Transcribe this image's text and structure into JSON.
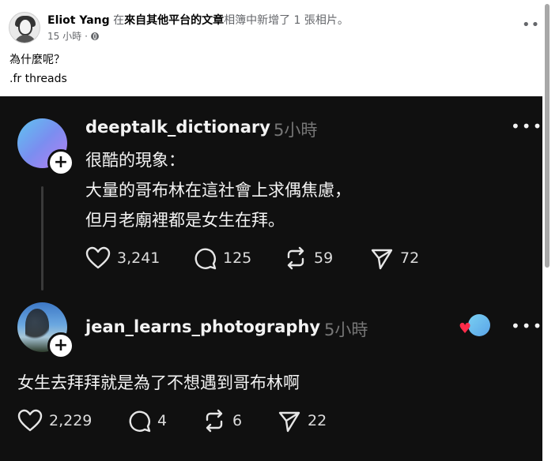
{
  "facebook_post": {
    "author": "Eliot Yang",
    "action_prefix": " 在",
    "album": "來自其他平台的文章",
    "action_suffix": "相簿中新增了 1 張相片。",
    "time": "15 小時",
    "time_sep": " · ",
    "privacy_icon": "globe-icon",
    "more_icon": "more-horizontal-icon",
    "text_line_1": "為什麼呢？",
    "text_line_2": ".fr threads"
  },
  "threads_post": {
    "username": "deeptalk_dictionary",
    "time": "5小時",
    "lines": [
      "很酷的現象：",
      "大量的哥布林在這社會上求偶焦慮，",
      "但月老廟裡都是女生在拜。"
    ],
    "stats": {
      "likes": "3,241",
      "comments": "125",
      "reposts": "59",
      "shares": "72"
    }
  },
  "threads_reply": {
    "username": "jean_learns_photography",
    "time": "5小時",
    "text": "女生去拜拜就是為了不想遇到哥布林啊",
    "stats": {
      "likes": "2,229",
      "comments": "4",
      "reposts": "6",
      "shares": "22"
    }
  },
  "icons": {
    "follow": "plus-icon",
    "like": "heart-icon",
    "comment": "comment-icon",
    "repost": "repost-icon",
    "share": "send-icon",
    "more": "more-horizontal-icon"
  },
  "colors": {
    "threads_bg": "#101010",
    "facebook_bg": "#ffffff",
    "accent_heart": "#ff2b4a"
  }
}
